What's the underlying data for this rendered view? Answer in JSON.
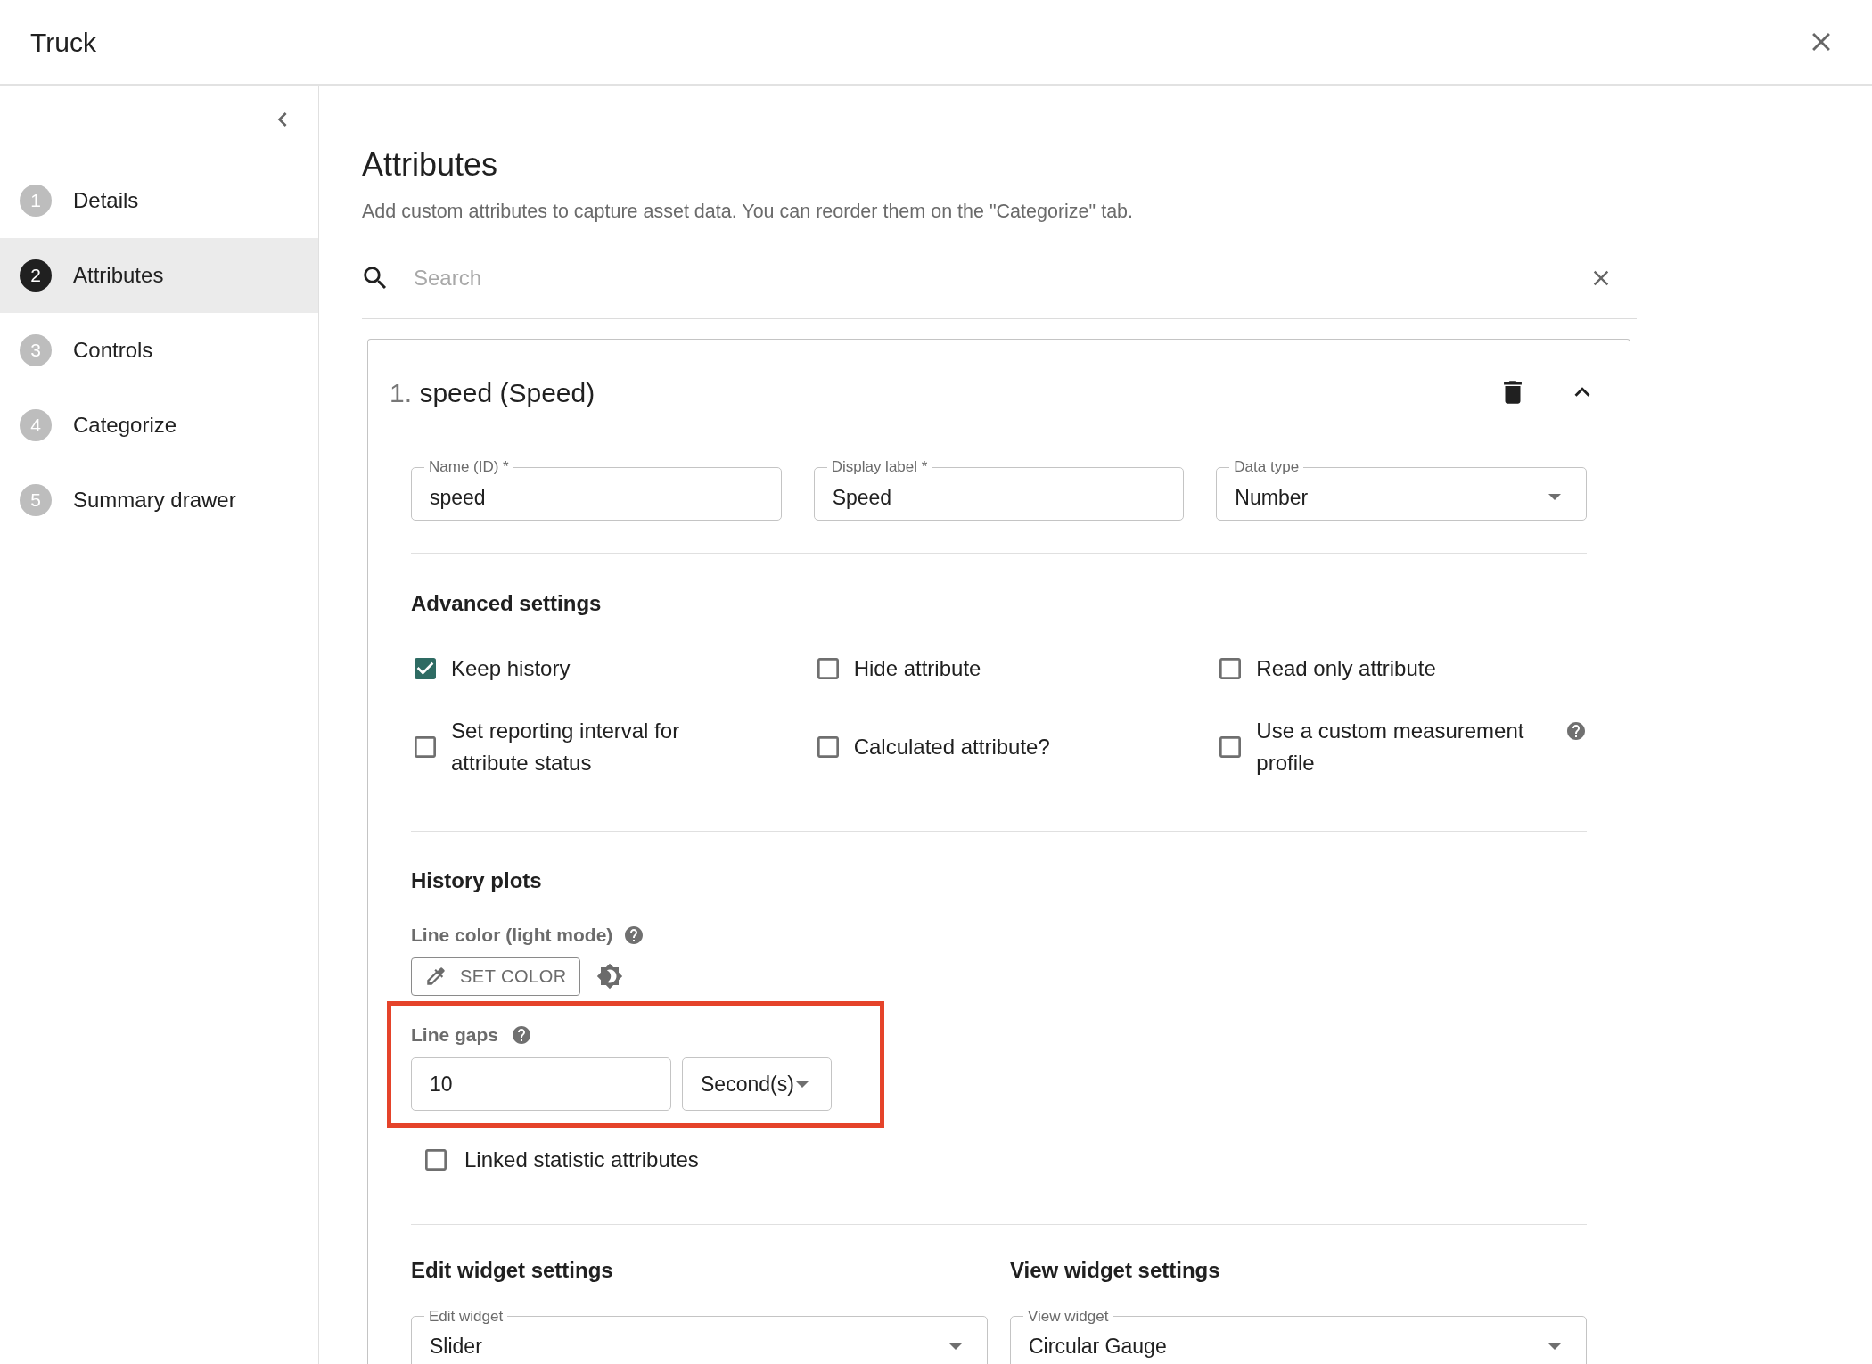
{
  "window": {
    "title": "Truck"
  },
  "steps": [
    {
      "number": "1",
      "label": "Details",
      "selected": false
    },
    {
      "number": "2",
      "label": "Attributes",
      "selected": true
    },
    {
      "number": "3",
      "label": "Controls",
      "selected": false
    },
    {
      "number": "4",
      "label": "Categorize",
      "selected": false
    },
    {
      "number": "5",
      "label": "Summary drawer",
      "selected": false
    }
  ],
  "page": {
    "title": "Attributes",
    "subtitle": "Add custom attributes to capture asset data. You can reorder them on the \"Categorize\" tab."
  },
  "search": {
    "placeholder": "Search"
  },
  "attribute": {
    "index": "1.",
    "title": "speed (Speed)",
    "expanded": true,
    "fields": [
      {
        "label": "Name (ID) *",
        "value": "speed",
        "kind": "text"
      },
      {
        "label": "Display label *",
        "value": "Speed",
        "kind": "text"
      },
      {
        "label": "Data type",
        "value": "Number",
        "kind": "select"
      }
    ],
    "advanced": {
      "title": "Advanced settings",
      "options": [
        {
          "label": "Keep history",
          "checked": true,
          "help": false
        },
        {
          "label": "Hide attribute",
          "checked": false,
          "help": false
        },
        {
          "label": "Read only attribute",
          "checked": false,
          "help": false
        },
        {
          "label": "Set reporting interval for attribute status",
          "checked": false,
          "help": false
        },
        {
          "label": "Calculated attribute?",
          "checked": false,
          "help": false
        },
        {
          "label": "Use a custom measurement profile",
          "checked": false,
          "help": true
        }
      ]
    },
    "history": {
      "title": "History plots",
      "line_color": {
        "label": "Line color (light mode)",
        "button": "SET COLOR"
      },
      "line_gaps": {
        "label": "Line gaps",
        "value": "10",
        "unit": "Second(s)",
        "highlighted": true
      },
      "linked": {
        "label": "Linked statistic attributes",
        "checked": false
      }
    },
    "widgets": [
      {
        "title": "Edit widget settings",
        "label": "Edit widget",
        "value": "Slider"
      },
      {
        "title": "View widget settings",
        "label": "View widget",
        "value": "Circular Gauge"
      }
    ]
  }
}
